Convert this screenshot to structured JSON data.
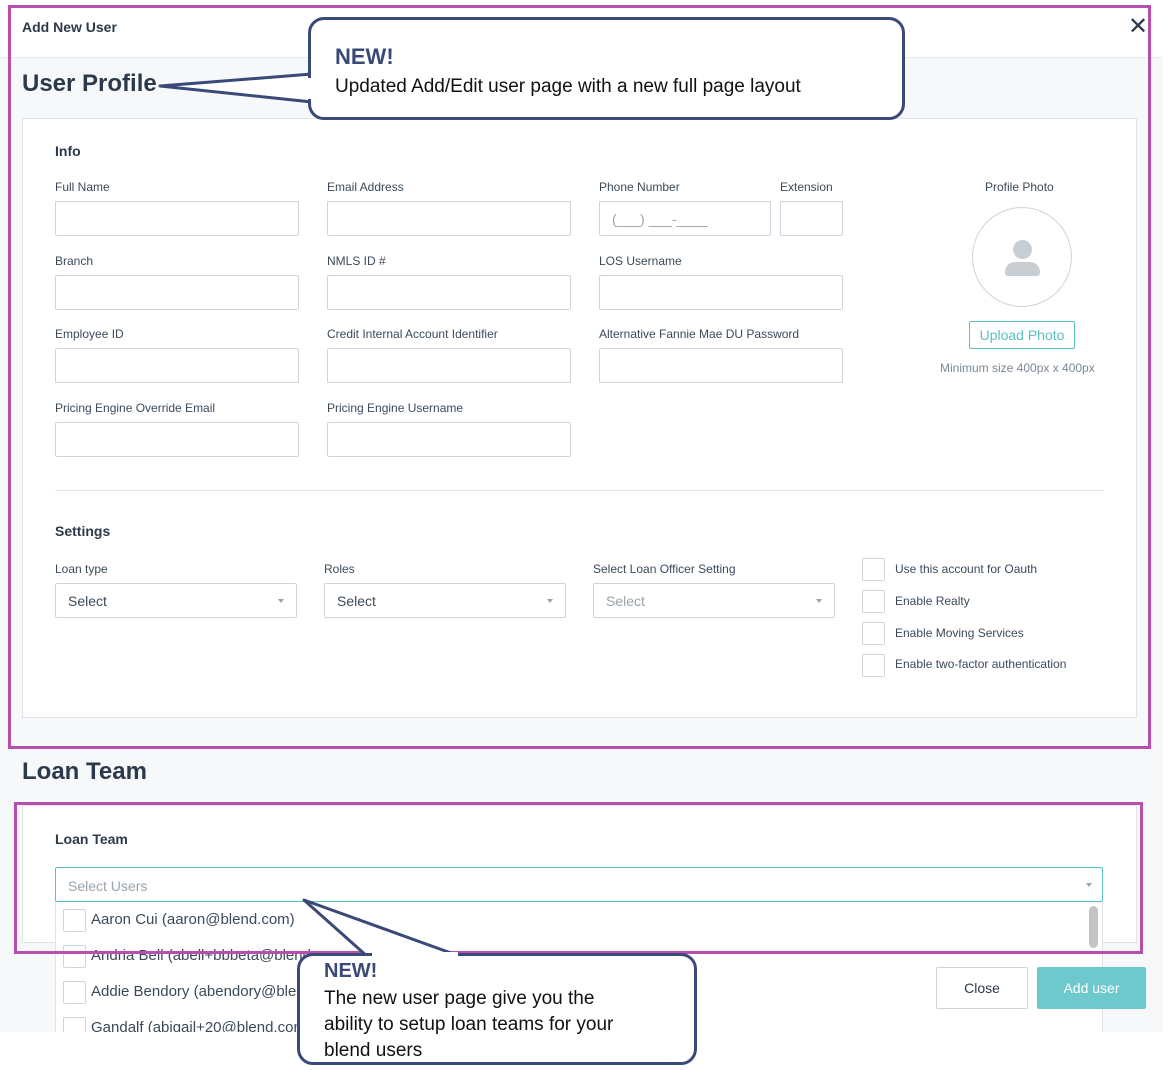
{
  "dialog": {
    "title": "Add New User"
  },
  "user_profile": {
    "section_title": "User Profile",
    "info": {
      "heading": "Info",
      "fields": {
        "full_name": {
          "label": "Full Name",
          "value": ""
        },
        "email": {
          "label": "Email Address",
          "value": ""
        },
        "phone": {
          "label": "Phone Number",
          "placeholder": "(___) ___-____"
        },
        "extension": {
          "label": "Extension",
          "value": ""
        },
        "branch": {
          "label": "Branch",
          "value": ""
        },
        "nmls": {
          "label": "NMLS ID #",
          "value": ""
        },
        "los_username": {
          "label": "LOS Username",
          "value": ""
        },
        "employee_id": {
          "label": "Employee ID",
          "value": ""
        },
        "credit_id": {
          "label": "Credit Internal Account Identifier",
          "value": ""
        },
        "fannie_du": {
          "label": "Alternative Fannie Mae DU Password",
          "value": ""
        },
        "pricing_email": {
          "label": "Pricing Engine Override Email",
          "value": ""
        },
        "pricing_username": {
          "label": "Pricing Engine Username",
          "value": ""
        }
      },
      "photo": {
        "label": "Profile Photo",
        "button": "Upload Photo",
        "hint": "Minimum size 400px x 400px",
        "icon": "user-avatar-icon"
      }
    },
    "settings": {
      "heading": "Settings",
      "loan_type": {
        "label": "Loan type",
        "value": "Select"
      },
      "roles": {
        "label": "Roles",
        "value": "Select"
      },
      "officer_setting": {
        "label": "Select Loan Officer Setting",
        "value": "Select"
      },
      "checkboxes": [
        "Use this account for Oauth",
        "Enable Realty",
        "Enable Moving Services",
        "Enable two-factor authentication"
      ]
    }
  },
  "loan_team": {
    "section_title": "Loan Team",
    "card_heading": "Loan Team",
    "select_placeholder": "Select Users",
    "users": [
      "Aaron Cui (aaron@blend.com)",
      "Andria Bell (abell+bbbeta@blend",
      "Addie Bendory (abendory@blen",
      "Gandalf (abigail+20@blend.com"
    ]
  },
  "footer": {
    "close": "Close",
    "add_user": "Add user"
  },
  "callouts": {
    "top": {
      "title": "NEW!",
      "body": "Updated Add/Edit user page with a new full page layout"
    },
    "bottom": {
      "title": "NEW!",
      "lines": [
        "The new user page give you the",
        "ability to setup loan teams for your",
        "blend users"
      ]
    }
  },
  "colors": {
    "accent": "#5bc0c4",
    "highlight": "#b84fb0",
    "callout": "#3a4a78"
  }
}
